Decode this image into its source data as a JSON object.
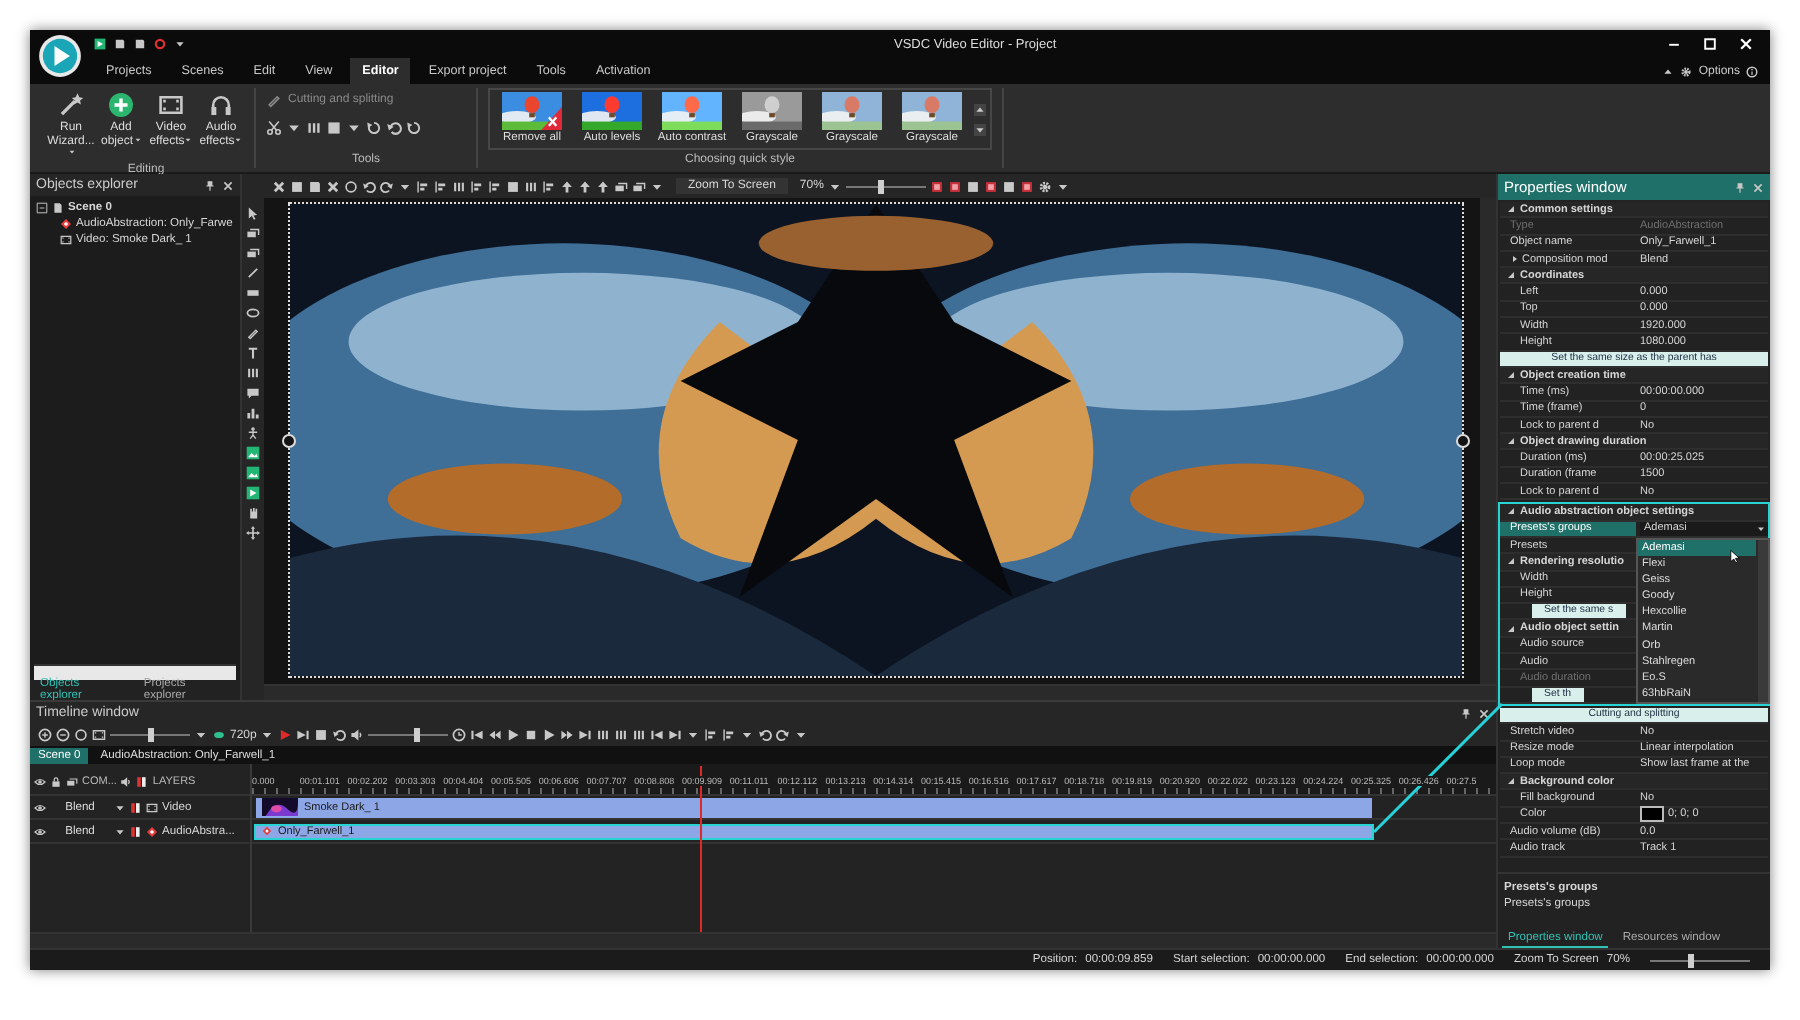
{
  "window": {
    "title": "VSDC Video Editor - Project",
    "options": "Options"
  },
  "menu": [
    {
      "label": "Projects",
      "selected": false
    },
    {
      "label": "Scenes",
      "selected": false
    },
    {
      "label": "Edit",
      "selected": false
    },
    {
      "label": "View",
      "selected": false
    },
    {
      "label": "Editor",
      "selected": true
    },
    {
      "label": "Export project",
      "selected": false
    },
    {
      "label": "Tools",
      "selected": false
    },
    {
      "label": "Activation",
      "selected": false
    }
  ],
  "ribbon": {
    "editing": {
      "title": "Editing",
      "buttons": [
        {
          "label": "Run Wizard...",
          "kind": "wand"
        },
        {
          "label": "Add object",
          "kind": "add"
        },
        {
          "label": "Video effects",
          "kind": "film"
        },
        {
          "label": "Audio effects",
          "kind": "headphones"
        }
      ]
    },
    "tools": {
      "title": "Tools",
      "action": "Cutting and splitting",
      "disabled": true
    },
    "quick_style": {
      "title": "Choosing quick style",
      "styles": [
        {
          "label": "Remove all",
          "kind": "remove"
        },
        {
          "label": "Auto levels",
          "kind": "vivid"
        },
        {
          "label": "Auto contrast",
          "kind": "bright"
        },
        {
          "label": "Grayscale",
          "kind": "gray"
        },
        {
          "label": "Grayscale",
          "kind": "muted"
        },
        {
          "label": "Grayscale",
          "kind": "muted"
        }
      ]
    }
  },
  "objects_explorer": {
    "title": "Objects explorer",
    "tree": [
      {
        "label": "Scene 0",
        "kind": "scene",
        "expanded": true,
        "children": [
          {
            "label": "AudioAbstraction: Only_Farwe",
            "kind": "audio"
          },
          {
            "label": "Video: Smoke Dark_ 1",
            "kind": "video"
          }
        ]
      }
    ],
    "tabs": [
      {
        "label": "Objects explorer",
        "selected": true
      },
      {
        "label": "Projects explorer",
        "selected": false
      }
    ]
  },
  "canvas": {
    "zoom_mode": "Zoom To Screen",
    "zoom": "70%",
    "zoom_slider": {
      "level": 0.45
    }
  },
  "timeline": {
    "title": "Timeline window",
    "resolution": "720p",
    "zoom_slider": {
      "level": 0.5
    },
    "volume_slider": {
      "level": 0.6
    },
    "scene_tabs": [
      {
        "label": "Scene 0",
        "selected": true
      },
      {
        "label": "AudioAbstraction: Only_Farwell_1",
        "selected": false
      }
    ],
    "header": {
      "column_1": "COM...",
      "layers": "LAYERS"
    },
    "ruler": [
      "0.000",
      "00:01.101",
      "00:02.202",
      "00:03.303",
      "00:04.404",
      "00:05.505",
      "00:06.606",
      "00:07.707",
      "00:08.808",
      "00:09.909",
      "00:11.011",
      "00:12.112",
      "00:13.213",
      "00:14.314",
      "00:15.415",
      "00:16.516",
      "00:17.617",
      "00:18.718",
      "00:19.819",
      "00:20.920",
      "00:22.022",
      "00:23.123",
      "00:24.224",
      "00:25.325",
      "00:26.426",
      "00:27.5"
    ],
    "tracks": [
      {
        "blend": "Blend",
        "kind": "video",
        "label": "Video",
        "clip": "Smoke Dark_ 1",
        "selected": false
      },
      {
        "blend": "Blend",
        "kind": "audio",
        "label": "AudioAbstra...",
        "clip": "Only_Farwell_1",
        "selected": true
      }
    ]
  },
  "properties": {
    "title": "Properties window",
    "groups": [
      {
        "title": "Common settings",
        "highlighted": false,
        "children": [
          {
            "kind": "field",
            "label": "Type",
            "value": "AudioAbstraction",
            "disabled": true
          },
          {
            "kind": "field",
            "label": "Object name",
            "value": "Only_Farwell_1",
            "disabled": false
          },
          {
            "kind": "folded",
            "label": "Composition mod",
            "value": "Blend"
          },
          {
            "kind": "section",
            "label": "Coordinates",
            "expanded": true,
            "children": [
              {
                "kind": "field",
                "label": "Left",
                "value": "0.000",
                "disabled": false
              },
              {
                "kind": "field",
                "label": "Top",
                "value": "0.000",
                "disabled": false
              },
              {
                "kind": "field",
                "label": "Width",
                "value": "1920.000",
                "disabled": false
              },
              {
                "kind": "field",
                "label": "Height",
                "value": "1080.000",
                "disabled": false
              },
              {
                "kind": "button",
                "label": "Set the same size as the parent has"
              }
            ]
          },
          {
            "kind": "section",
            "label": "Object creation time",
            "expanded": true,
            "children": [
              {
                "kind": "field",
                "label": "Time (ms)",
                "value": "00:00:00.000",
                "disabled": false
              },
              {
                "kind": "field",
                "label": "Time (frame)",
                "value": "0",
                "disabled": false
              },
              {
                "kind": "field",
                "label": "Lock to parent d",
                "value": "No",
                "disabled": false
              }
            ]
          },
          {
            "kind": "section",
            "label": "Object drawing duration",
            "expanded": true,
            "children": [
              {
                "kind": "field",
                "label": "Duration (ms)",
                "value": "00:00:25.025",
                "disabled": false
              },
              {
                "kind": "field",
                "label": "Duration (frame",
                "value": "1500",
                "disabled": false
              },
              {
                "kind": "field",
                "label": "Lock to parent d",
                "value": "No",
                "disabled": false
              }
            ]
          }
        ]
      },
      {
        "title": "Audio abstraction object settings",
        "highlighted": true,
        "children": [
          {
            "kind": "dropdown",
            "label": "Presets's groups",
            "value": "Ademasi",
            "open": true,
            "options": [
              {
                "label": "Ademasi",
                "selected": true
              },
              {
                "label": "Flexi",
                "selected": false
              },
              {
                "label": "Geiss",
                "selected": false
              },
              {
                "label": "Goody",
                "selected": false
              },
              {
                "label": "Hexcollie",
                "selected": false
              },
              {
                "label": "Martin",
                "selected": false
              },
              {
                "label": "Orb",
                "selected": false
              },
              {
                "label": "Stahlregen",
                "selected": false
              },
              {
                "label": "Eo.S",
                "selected": false
              },
              {
                "label": "63hbRaiN",
                "selected": false
              }
            ]
          },
          {
            "kind": "field",
            "label": "Presets",
            "disabled": false
          },
          {
            "kind": "section",
            "label": "Rendering resolutio",
            "expanded": true,
            "children": [
              {
                "kind": "field",
                "label": "Width",
                "disabled": false
              },
              {
                "kind": "field",
                "label": "Height",
                "disabled": false
              },
              {
                "kind": "button",
                "label": "Set the same s"
              }
            ]
          },
          {
            "kind": "section",
            "label": "Audio object settin",
            "expanded": true,
            "children": [
              {
                "kind": "field",
                "label": "Audio source",
                "disabled": false
              },
              {
                "kind": "field",
                "label": "Audio",
                "disabled": false
              },
              {
                "kind": "field",
                "label": "Audio duration",
                "disabled": true
              },
              {
                "kind": "button",
                "label": "Set th"
              }
            ]
          }
        ]
      },
      {
        "highlighted": false,
        "children": [
          {
            "kind": "button",
            "label": "Cutting and splitting"
          },
          {
            "kind": "field",
            "label": "Stretch video",
            "value": "No",
            "disabled": false
          },
          {
            "kind": "field",
            "label": "Resize mode",
            "value": "Linear interpolation",
            "disabled": false
          },
          {
            "kind": "field",
            "label": "Loop mode",
            "value": "Show last frame at the",
            "disabled": false
          },
          {
            "kind": "section",
            "label": "Background color",
            "expanded": true,
            "children": [
              {
                "kind": "field",
                "label": "Fill background",
                "value": "No",
                "disabled": false
              },
              {
                "kind": "color",
                "label": "Color",
                "value": "0; 0; 0",
                "color": "#000000"
              }
            ]
          },
          {
            "kind": "field",
            "label": "Audio volume (dB)",
            "value": "0.0",
            "disabled": false
          },
          {
            "kind": "field",
            "label": "Audio track",
            "value": "Track 1",
            "disabled": false
          }
        ]
      }
    ],
    "description": {
      "title": "Presets's groups",
      "text": "Presets's groups"
    },
    "tabs": [
      {
        "label": "Properties window",
        "selected": true
      },
      {
        "label": "Resources window",
        "selected": false
      }
    ]
  },
  "status_bar": {
    "items": [
      {
        "label": "Position:",
        "value": "00:00:09.859"
      },
      {
        "label": "Start selection:",
        "value": "00:00:00.000"
      },
      {
        "label": "End selection:",
        "value": "00:00:00.000"
      }
    ],
    "zoom_mode": "Zoom To Screen",
    "zoom": "70%",
    "zoom_slider": {
      "level": 0.4
    }
  }
}
